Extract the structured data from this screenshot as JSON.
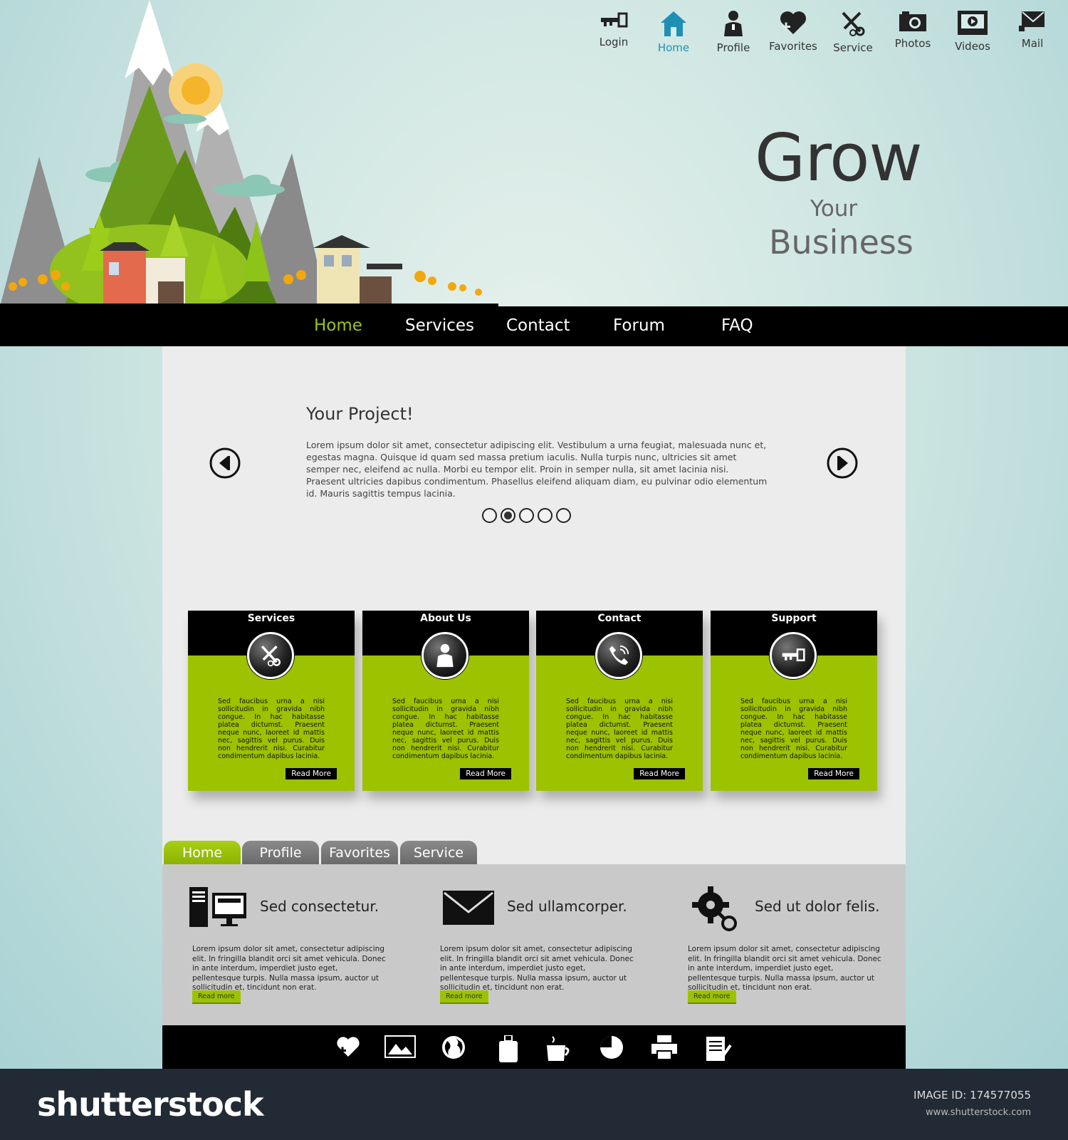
{
  "topnav": {
    "items": [
      {
        "label": "Login",
        "icon": "key-icon"
      },
      {
        "label": "Home",
        "icon": "home-icon",
        "active": true
      },
      {
        "label": "Profile",
        "icon": "person-icon"
      },
      {
        "label": "Favorites",
        "icon": "heart-plus-icon"
      },
      {
        "label": "Service",
        "icon": "tools-icon"
      },
      {
        "label": "Photos",
        "icon": "camera-icon"
      },
      {
        "label": "Videos",
        "icon": "video-icon"
      },
      {
        "label": "Mail",
        "icon": "envelope-icon"
      }
    ]
  },
  "hero": {
    "line1": "Grow",
    "line2": "Your",
    "line3": "Business"
  },
  "mainnav": {
    "items": [
      "Home",
      "Services",
      "Contact",
      "Forum",
      "FAQ"
    ],
    "active": "Home"
  },
  "slider": {
    "title": "Your Project!",
    "text": "Lorem ipsum dolor sit amet, consectetur adipiscing elit. Vestibulum a urna feugiat, malesuada nunc et, egestas magna. Quisque id quam sed massa pretium iaculis. Nulla turpis nunc, ultricies sit amet semper nec, eleifend ac nulla. Morbi eu tempor elit. Proin in semper nulla, sit amet lacinia nisi. Praesent ultricies dapibus condimentum. Phasellus eleifend aliquam diam, eu pulvinar odio elementum id. Mauris sagittis tempus lacinia.",
    "dot_count": 5,
    "active_dot": 2
  },
  "cards": [
    {
      "title": "Services",
      "icon": "tools-icon",
      "text": "Sed faucibus urna a nisi sollicitudin in gravida nibh congue. In hac habitasse platea dictumst. Praesent neque nunc, laoreet id mattis nec, sagittis vel purus. Duis non hendrerit nisi. Curabitur condimentum dapibus lacinia.",
      "button": "Read More"
    },
    {
      "title": "About Us",
      "icon": "person-icon",
      "text": "Sed faucibus urna a nisi sollicitudin in gravida nibh congue. In hac habitasse platea dictumst. Praesent neque nunc, laoreet id mattis nec, sagittis vel purus. Duis non hendrerit nisi. Curabitur condimentum dapibus lacinia.",
      "button": "Read More"
    },
    {
      "title": "Contact",
      "icon": "phone-icon",
      "text": "Sed faucibus urna a nisi sollicitudin in gravida nibh congue. In hac habitasse platea dictumst. Praesent neque nunc, laoreet id mattis nec, sagittis vel purus. Duis non hendrerit nisi. Curabitur condimentum dapibus lacinia.",
      "button": "Read More"
    },
    {
      "title": "Support",
      "icon": "key-icon",
      "text": "Sed faucibus urna a nisi sollicitudin in gravida nibh congue. In hac habitasse platea dictumst. Praesent neque nunc, laoreet id mattis nec, sagittis vel purus. Duis non hendrerit nisi. Curabitur condimentum dapibus lacinia.",
      "button": "Read More"
    }
  ],
  "tabs": {
    "items": [
      "Home",
      "Profile",
      "Favorites",
      "Service"
    ],
    "active": "Home"
  },
  "features": [
    {
      "title": "Sed consectetur.",
      "icon": "computer-icon",
      "text": "Lorem ipsum dolor sit amet, consectetur adipiscing elit. In fringilla blandit orci sit amet vehicula. Donec in ante interdum, imperdiet justo eget, pellentesque turpis. Nulla massa ipsum, auctor ut sollicitudin et, tincidunt non erat.",
      "button": "Read more"
    },
    {
      "title": "Sed ullamcorper.",
      "icon": "envelope-icon",
      "text": "Lorem ipsum dolor sit amet, consectetur adipiscing elit. In fringilla blandit orci sit amet vehicula. Donec in ante interdum, imperdiet justo eget, pellentesque turpis. Nulla massa ipsum, auctor ut sollicitudin et, tincidunt non erat.",
      "button": "Read more"
    },
    {
      "title": "Sed ut dolor felis.",
      "icon": "gears-icon",
      "text": "Lorem ipsum dolor sit amet, consectetur adipiscing elit. In fringilla blandit orci sit amet vehicula. Donec in ante interdum, imperdiet justo eget, pellentesque turpis. Nulla massa ipsum, auctor ut sollicitudin et, tincidunt non erat.",
      "button": "Read more"
    }
  ],
  "footer_icons": [
    "heart-plus-icon",
    "picture-icon",
    "globe-icon",
    "luggage-icon",
    "coffee-cup-icon",
    "pie-chart-icon",
    "printer-icon",
    "notepad-icon"
  ],
  "watermark": {
    "brand": "shutterstock",
    "image_id_label": "IMAGE ID:",
    "image_id": "174577055",
    "url": "www.shutterstock.com"
  },
  "colors": {
    "accent": "#9dc200",
    "active_link": "#1f8fb5",
    "nav_bg": "#000000"
  }
}
